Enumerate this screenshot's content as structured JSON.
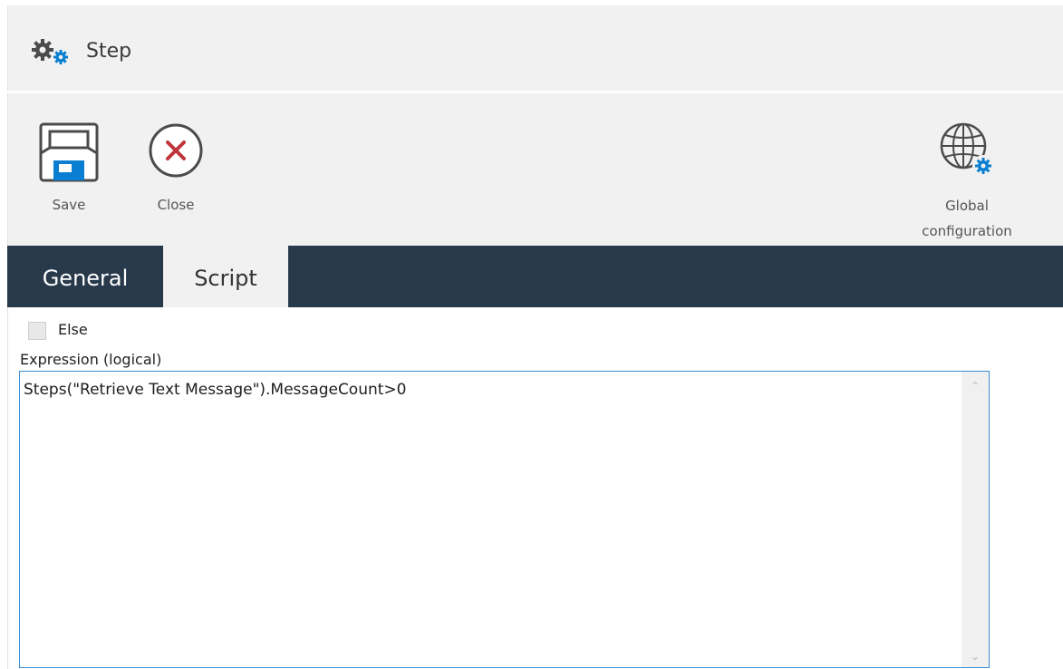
{
  "window": {
    "title": "Step",
    "title_icon": "gears-icon"
  },
  "toolbar": {
    "save_label": "Save",
    "close_label": "Close",
    "global_label_line1": "Global",
    "global_label_line2": "configuration"
  },
  "tabs": [
    {
      "label": "General",
      "active": false
    },
    {
      "label": "Script",
      "active": true
    }
  ],
  "form": {
    "else_label": "Else",
    "else_checked": false,
    "expression_label": "Expression (logical)",
    "expression_value": "Steps(\"Retrieve Text Message\").MessageCount>0"
  },
  "colors": {
    "tabbar": "#27394a",
    "accent_blue": "#0a7fd1",
    "close_red": "#c0343b",
    "focus_border": "#3c8ed8"
  }
}
